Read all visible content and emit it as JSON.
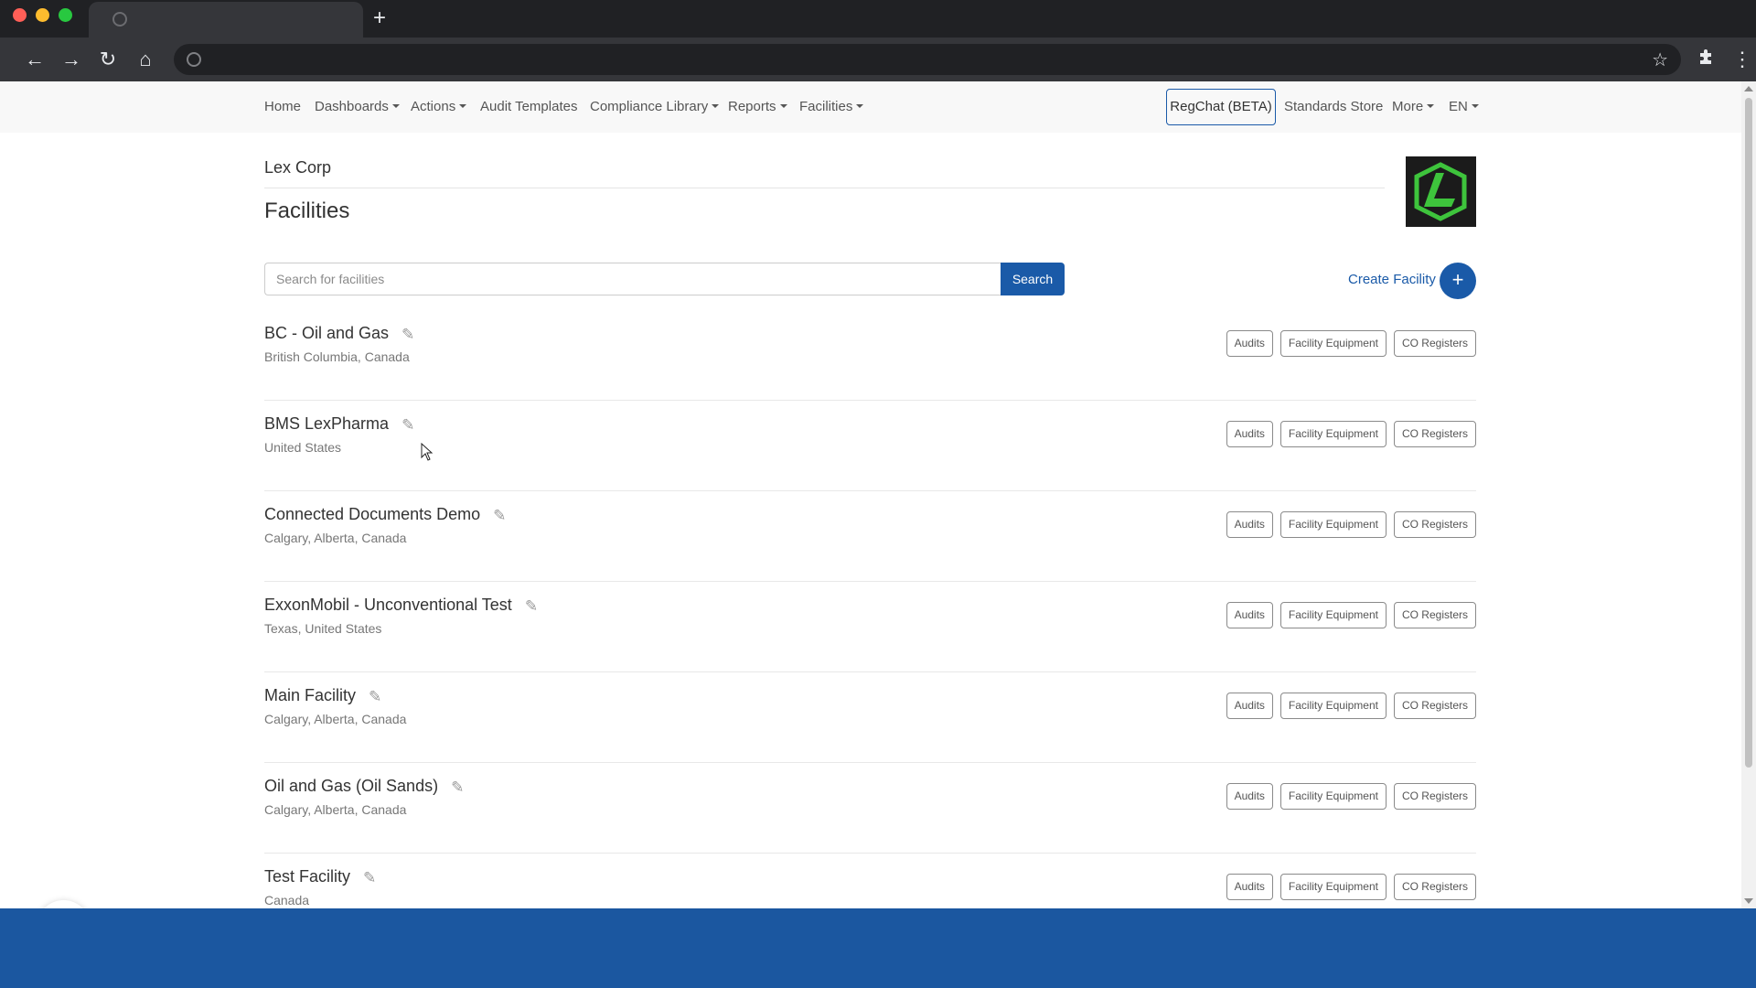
{
  "browser": {
    "tab_icon": "globe-icon",
    "new_tab_label": "+",
    "nav_icons": [
      "back-arrow-icon",
      "forward-arrow-icon",
      "reload-icon",
      "home-icon"
    ]
  },
  "nav": {
    "items": [
      {
        "label": "Home",
        "dropdown": false
      },
      {
        "label": "Dashboards",
        "dropdown": true
      },
      {
        "label": "Actions",
        "dropdown": true
      },
      {
        "label": "Audit Templates",
        "dropdown": false
      },
      {
        "label": "Compliance Library",
        "dropdown": true
      },
      {
        "label": "Reports",
        "dropdown": true
      },
      {
        "label": "Facilities",
        "dropdown": true
      }
    ],
    "regchat": "RegChat (BETA)",
    "standards_store": "Standards Store",
    "more": "More",
    "lang": "EN"
  },
  "header": {
    "company": "Lex Corp",
    "title": "Facilities"
  },
  "search": {
    "placeholder": "Search for facilities",
    "button": "Search"
  },
  "create": {
    "label": "Create Facility",
    "icon": "+"
  },
  "facility_actions": [
    "Audits",
    "Facility Equipment",
    "CO Registers"
  ],
  "facilities": [
    {
      "name": "BC - Oil and Gas",
      "location": "British Columbia, Canada"
    },
    {
      "name": "BMS LexPharma",
      "location": "United States"
    },
    {
      "name": "Connected Documents Demo",
      "location": "Calgary, Alberta, Canada"
    },
    {
      "name": "ExxonMobil - Unconventional Test",
      "location": "Texas, United States"
    },
    {
      "name": "Main Facility",
      "location": "Calgary, Alberta, Canada"
    },
    {
      "name": "Oil and Gas (Oil Sands)",
      "location": "Calgary, Alberta, Canada"
    },
    {
      "name": "Test Facility",
      "location": "Canada"
    }
  ],
  "widget": {
    "label": "g."
  },
  "colors": {
    "brand": "#1a5aa8",
    "bottom_bar": "#1b57a0",
    "logo_green": "#3ec43c"
  }
}
